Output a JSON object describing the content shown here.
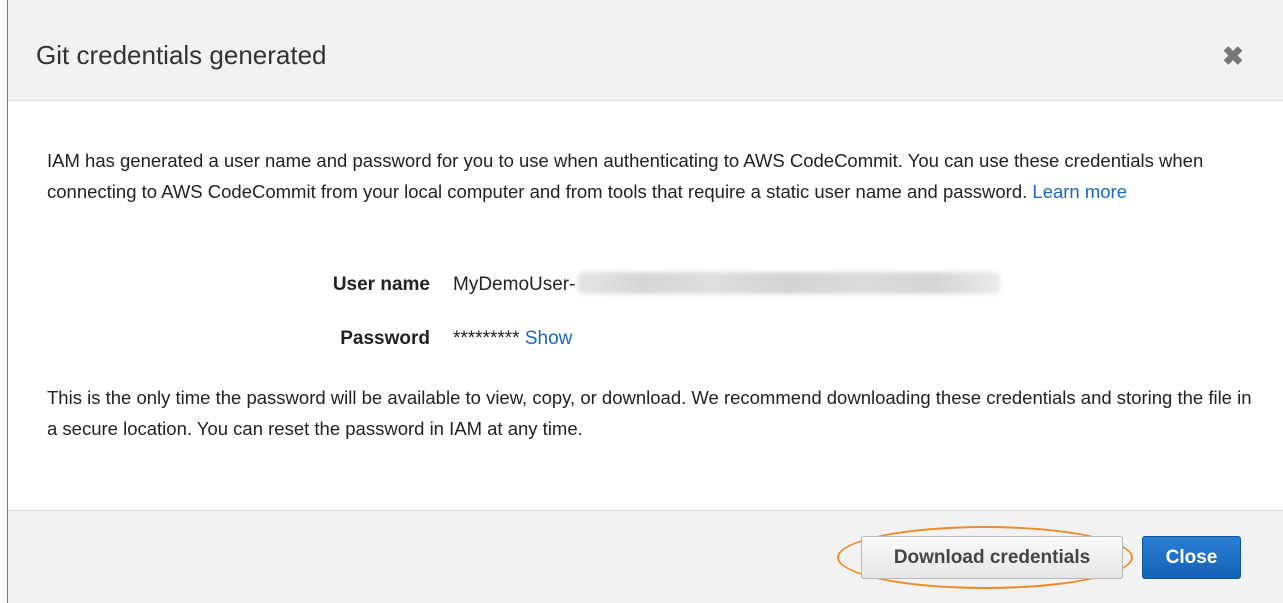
{
  "dialog": {
    "title": "Git credentials generated",
    "close_icon": "close-x-icon"
  },
  "intro": {
    "text": "IAM has generated a user name and password for you to use when authenticating to AWS CodeCommit. You can use these credentials when connecting to AWS CodeCommit from your local computer and from tools that require a static user name and password.",
    "learn_more_label": "Learn more"
  },
  "credentials": {
    "user_name_label": "User name",
    "user_name_value": "MyDemoUser-",
    "password_label": "Password",
    "password_value": "*********",
    "show_label": "Show"
  },
  "notice": {
    "text": "This is the only time the password will be available to view, copy, or download. We recommend downloading these credentials and storing the file in a secure location. You can reset the password in IAM at any time."
  },
  "footer": {
    "download_label": "Download credentials",
    "close_label": "Close"
  },
  "colors": {
    "link": "#1a66c1",
    "primary_button": "#1f6fc5",
    "highlight": "#f08a24",
    "header_footer_bg": "#f2f2f2"
  }
}
